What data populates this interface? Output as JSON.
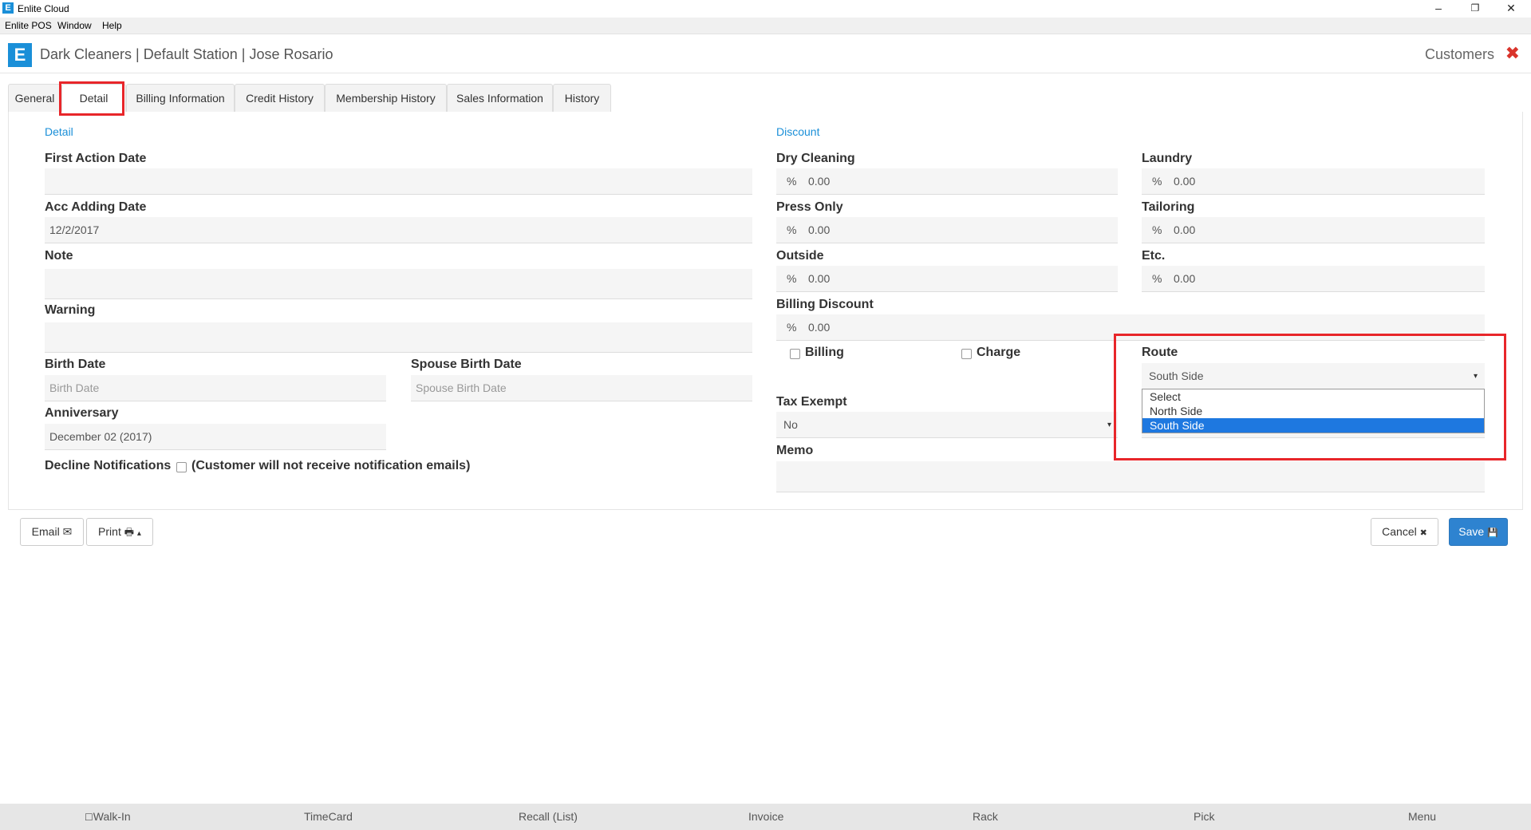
{
  "window": {
    "app_logo": "E",
    "title": "Enlite Cloud",
    "minimize_glyph": "–",
    "restore_glyph": "❐",
    "close_glyph": "✕"
  },
  "menubar": {
    "items": [
      "Enlite POS",
      "Window",
      "Help"
    ]
  },
  "header": {
    "logo": "E",
    "title": "Dark Cleaners | Default Station | Jose Rosario",
    "section": "Customers",
    "close_glyph": "✖"
  },
  "tabs": [
    "General",
    "Detail",
    "Billing Information",
    "Credit History",
    "Membership History",
    "Sales Information",
    "History"
  ],
  "detail": {
    "section_title": "Detail",
    "first_action_date": {
      "label": "First Action Date",
      "value": ""
    },
    "acc_adding_date": {
      "label": "Acc Adding Date",
      "value": "12/2/2017"
    },
    "note": {
      "label": "Note",
      "value": ""
    },
    "warning": {
      "label": "Warning",
      "value": ""
    },
    "birth_date": {
      "label": "Birth Date",
      "placeholder": "Birth Date"
    },
    "spouse_birth_date": {
      "label": "Spouse Birth Date",
      "placeholder": "Spouse Birth Date"
    },
    "anniversary": {
      "label": "Anniversary",
      "value": "December 02 (2017)"
    },
    "decline_notifications": {
      "label": "Decline Notifications",
      "note": "(Customer will not receive notification emails)"
    }
  },
  "discount": {
    "section_title": "Discount",
    "percent_symbol": "%",
    "dry_cleaning": {
      "label": "Dry Cleaning",
      "value": "0.00"
    },
    "laundry": {
      "label": "Laundry",
      "value": "0.00"
    },
    "press_only": {
      "label": "Press Only",
      "value": "0.00"
    },
    "tailoring": {
      "label": "Tailoring",
      "value": "0.00"
    },
    "outside": {
      "label": "Outside",
      "value": "0.00"
    },
    "etc": {
      "label": "Etc.",
      "value": "0.00"
    },
    "billing_discount": {
      "label": "Billing Discount",
      "value": "0.00"
    },
    "billing_checkbox": "Billing",
    "charge_checkbox": "Charge",
    "tax_exempt": {
      "label": "Tax Exempt",
      "value": "No"
    },
    "memo": {
      "label": "Memo",
      "value": ""
    },
    "route": {
      "label": "Route",
      "value": "South Side",
      "options": [
        "Select",
        "North Side",
        "South Side"
      ],
      "selected_index": 2
    },
    "caret_glyph": "▾"
  },
  "actions": {
    "email": "Email",
    "print": "Print",
    "cancel": "Cancel",
    "save": "Save",
    "email_icon": "✉",
    "print_icon": "🖶",
    "print_caret": "▴",
    "cancel_icon": "✖",
    "save_icon": "💾"
  },
  "bottom_bar": {
    "walkin_icon": "☐",
    "items": [
      "Walk-In",
      "TimeCard",
      "Recall (List)",
      "Invoice",
      "Rack",
      "Pick",
      "Menu"
    ]
  },
  "colors": {
    "accent": "#1a8fd8",
    "highlight": "#e8262a",
    "primary_button": "#2e83d0",
    "selected_option": "#1e78e0"
  }
}
